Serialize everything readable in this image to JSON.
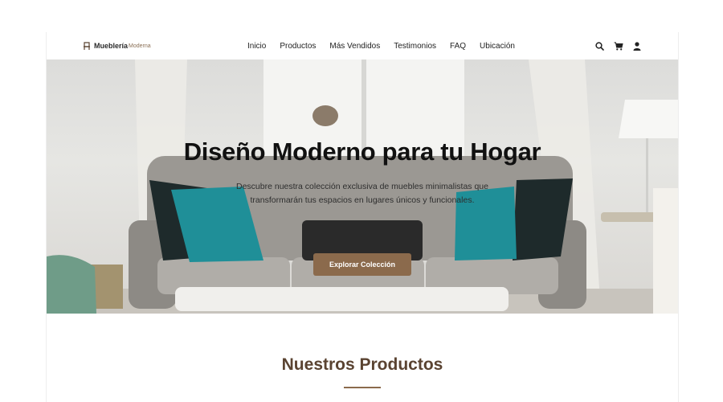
{
  "brand": {
    "name": "Mueblería",
    "tag": "Moderna"
  },
  "nav": {
    "links": [
      "Inicio",
      "Productos",
      "Más Vendidos",
      "Testimonios",
      "FAQ",
      "Ubicación"
    ]
  },
  "icons": [
    "search-icon",
    "cart-icon",
    "user-icon"
  ],
  "hero": {
    "title": "Diseño Moderno para tu Hogar",
    "subtitle_line1": "Descubre nuestra colección exclusiva de muebles minimalistas que",
    "subtitle_line2": "transformarán tus espacios en lugares únicos y funcionales.",
    "cta": "Explorar Colección"
  },
  "products": {
    "title": "Nuestros Productos"
  },
  "colors": {
    "accent": "#8b6a4c",
    "heading": "#5a4331",
    "text": "#222222"
  }
}
